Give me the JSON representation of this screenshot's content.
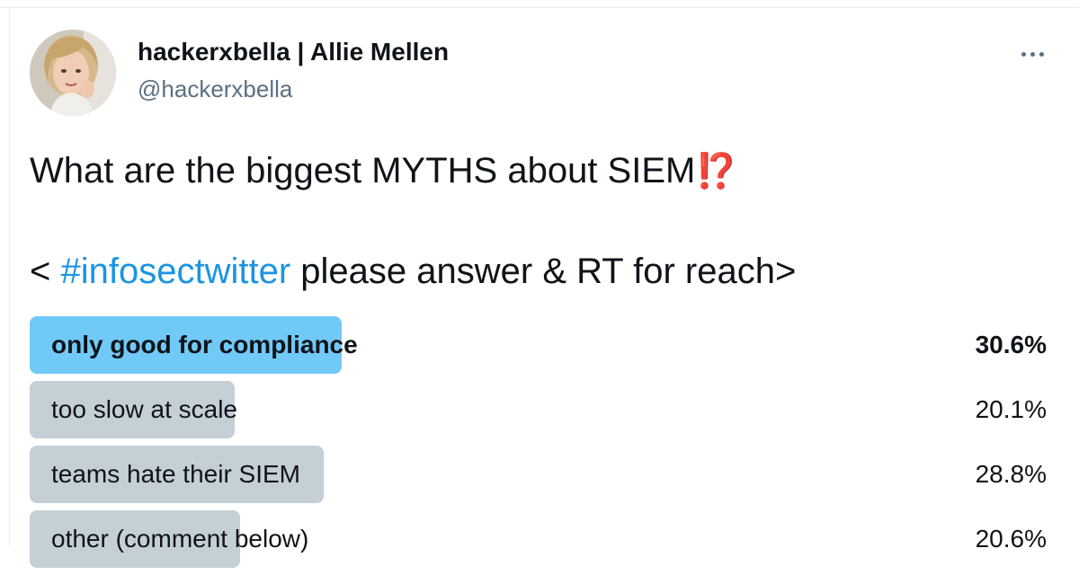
{
  "author": {
    "display_name": "hackerxbella | Allie Mellen",
    "handle": "@hackerxbella"
  },
  "tweet": {
    "line1": "What are the biggest MYTHS about SIEM",
    "line1_emoji": "⁉️",
    "line2_prefix": "< ",
    "hashtag": "#infosectwitter",
    "line2_suffix": " please answer & RT for reach>"
  },
  "poll": {
    "options": [
      {
        "label": "only good for compliance",
        "percent_label": "30.6%",
        "percent": 30.6,
        "winner": true
      },
      {
        "label": "too slow at scale",
        "percent_label": "20.1%",
        "percent": 20.1,
        "winner": false
      },
      {
        "label": "teams hate their SIEM",
        "percent_label": "28.8%",
        "percent": 28.8,
        "winner": false
      },
      {
        "label": "other (comment below)",
        "percent_label": "20.6%",
        "percent": 20.6,
        "winner": false
      }
    ]
  },
  "colors": {
    "winner_bar": "#71c9f8",
    "other_bar": "#c4cfd6",
    "hashtag": "#1b95e0",
    "handle": "#5b7083",
    "emoji": "#be1931"
  },
  "icons": {
    "more": "more-icon"
  }
}
